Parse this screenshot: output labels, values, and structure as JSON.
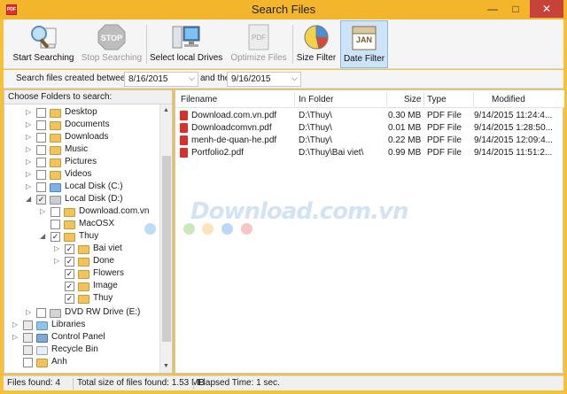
{
  "window": {
    "title": "Search Files",
    "app_icon_text": "PDF"
  },
  "toolbar": {
    "start_label": "Start Searching",
    "stop_label": "Stop Searching",
    "stop_icon_text": "STOP",
    "select_label": "Select local Drives",
    "optimize_label": "Optimize Files",
    "optimize_icon_text": "PDF",
    "size_label": "Size Filter",
    "date_label": "Date Filter",
    "date_icon_text": "JAN"
  },
  "dates": {
    "label": "Search files created between:",
    "from": "8/16/2015",
    "and_label": "and the",
    "to": "9/16/2015"
  },
  "tree": {
    "header": "Choose Folders to search:",
    "nodes": [
      {
        "label": "Desktop"
      },
      {
        "label": "Documents"
      },
      {
        "label": "Downloads"
      },
      {
        "label": "Music"
      },
      {
        "label": "Pictures"
      },
      {
        "label": "Videos"
      },
      {
        "label": "Local Disk (C:)"
      },
      {
        "label": "Local Disk (D:)"
      },
      {
        "label": "Download.com.vn"
      },
      {
        "label": "MacOSX"
      },
      {
        "label": "Thuy"
      },
      {
        "label": "Bai viet"
      },
      {
        "label": "Done"
      },
      {
        "label": "Flowers"
      },
      {
        "label": "Image"
      },
      {
        "label": "Thuy"
      },
      {
        "label": "DVD RW Drive (E:)"
      },
      {
        "label": "Libraries"
      },
      {
        "label": "Control Panel"
      },
      {
        "label": "Recycle Bin"
      },
      {
        "label": "Anh"
      }
    ]
  },
  "results": {
    "columns": {
      "filename": "Filename",
      "folder": "In Folder",
      "size": "Size",
      "type": "Type",
      "modified": "Modified"
    },
    "rows": [
      {
        "name": "Download.com.vn.pdf",
        "folder": "D:\\Thuy\\",
        "size": "0.30 MB",
        "type": "PDF File",
        "modified": "9/14/2015 11:24:4..."
      },
      {
        "name": "Downloadcomvn.pdf",
        "folder": "D:\\Thuy\\",
        "size": "0.01 MB",
        "type": "PDF File",
        "modified": "9/14/2015 1:28:50..."
      },
      {
        "name": "menh-de-quan-he.pdf",
        "folder": "D:\\Thuy\\",
        "size": "0.22 MB",
        "type": "PDF File",
        "modified": "9/14/2015 12:09:4..."
      },
      {
        "name": "Portfolio2.pdf",
        "folder": "D:\\Thuy\\Bai viet\\",
        "size": "0.99 MB",
        "type": "PDF File",
        "modified": "9/14/2015 11:51:2..."
      }
    ]
  },
  "watermark": "Download.com.vn",
  "status": {
    "files_found": "Files found: 4",
    "total_size": "Total size of files found: 1.53 MB",
    "elapsed": "Elapsed Time: 1 sec."
  },
  "colors": {
    "accent": "#f2b52c",
    "selection": "#cde3f7",
    "pdf_red": "#d9302c"
  }
}
